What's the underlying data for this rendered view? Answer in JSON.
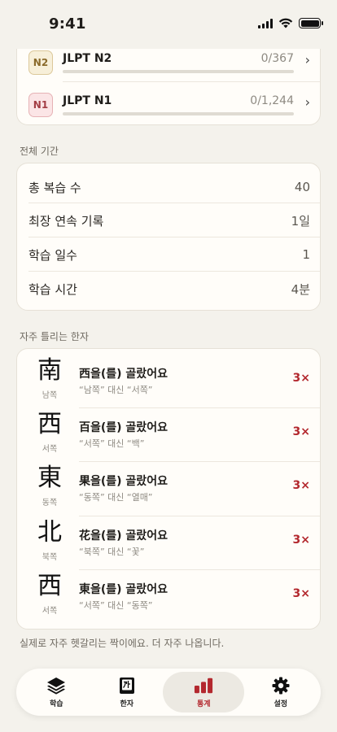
{
  "status_bar": {
    "time": "9:41"
  },
  "jlpt_levels": [
    {
      "badge": "N2",
      "name": "JLPT N2",
      "count": "0/367",
      "progress": 0
    },
    {
      "badge": "N1",
      "name": "JLPT N1",
      "count": "0/1,244",
      "progress": 0
    }
  ],
  "overall": {
    "section_label": "전체 기간",
    "stats": [
      {
        "label": "총 복습 수",
        "value": "40"
      },
      {
        "label": "최장 연속 기록",
        "value": "1일"
      },
      {
        "label": "학습 일수",
        "value": "1"
      },
      {
        "label": "학습 시간",
        "value": "4분"
      }
    ]
  },
  "mistakes": {
    "section_label": "자주 틀리는 한자",
    "items": [
      {
        "kanji": "南",
        "reading": "남쪽",
        "title": "西을(를) 골랐어요",
        "sub": "“남쪽” 대신 “서쪽”",
        "count": "3×"
      },
      {
        "kanji": "西",
        "reading": "서쪽",
        "title": "百을(를) 골랐어요",
        "sub": "“서쪽” 대신 “백”",
        "count": "3×"
      },
      {
        "kanji": "東",
        "reading": "동쪽",
        "title": "果을(를) 골랐어요",
        "sub": "“동쪽” 대신 “열매”",
        "count": "3×"
      },
      {
        "kanji": "北",
        "reading": "북쪽",
        "title": "花을(를) 골랐어요",
        "sub": "“북쪽” 대신 “꽃”",
        "count": "3×"
      },
      {
        "kanji": "西",
        "reading": "서쪽",
        "title": "東을(를) 골랐어요",
        "sub": "“서쪽” 대신 “동쪽”",
        "count": "3×"
      }
    ],
    "footnote": "실제로 자주 헷갈리는 짝이에요. 더 자주 나옵니다."
  },
  "tab_bar": {
    "tabs": [
      {
        "label": "학습",
        "icon": "layers-icon"
      },
      {
        "label": "한자",
        "icon": "kanji-book-icon"
      },
      {
        "label": "통계",
        "icon": "bar-chart-icon",
        "active": true
      },
      {
        "label": "설정",
        "icon": "gear-icon"
      }
    ]
  },
  "colors": {
    "accent": "#b3282e",
    "background": "#f4f2ec",
    "card": "#fffdf9"
  }
}
